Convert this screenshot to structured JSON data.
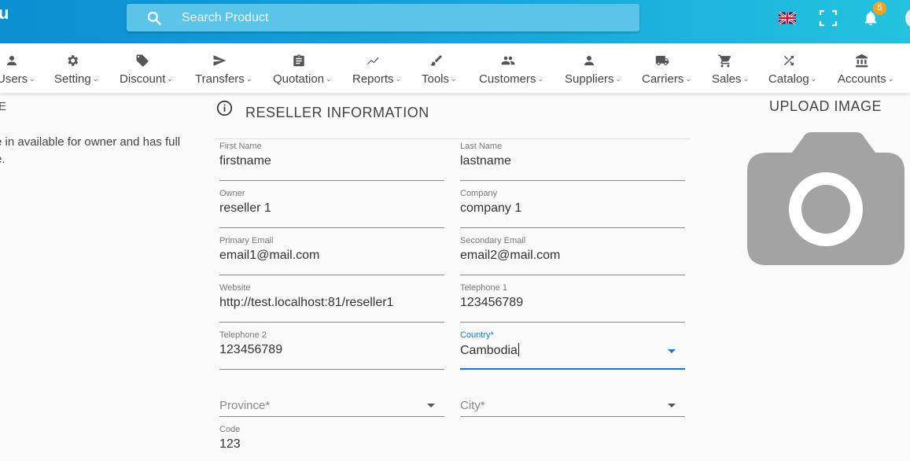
{
  "header": {
    "logo_fragment": "u",
    "search_placeholder": "Search Product",
    "notifications_count": "5",
    "language": "English (UK flag)"
  },
  "nav": {
    "items": [
      {
        "label": "Users",
        "icon": "person-icon"
      },
      {
        "label": "Setting",
        "icon": "gear-icon"
      },
      {
        "label": "Discount",
        "icon": "tag-icon"
      },
      {
        "label": "Transfers",
        "icon": "send-icon"
      },
      {
        "label": "Quotation",
        "icon": "clipboard-icon"
      },
      {
        "label": "Reports",
        "icon": "trend-icon"
      },
      {
        "label": "Tools",
        "icon": "brush-icon"
      },
      {
        "label": "Customers",
        "icon": "people-icon"
      },
      {
        "label": "Suppliers",
        "icon": "person-icon"
      },
      {
        "label": "Carriers",
        "icon": "truck-icon"
      },
      {
        "label": "Sales",
        "icon": "cart-icon"
      },
      {
        "label": "Catalog",
        "icon": "shuffle-icon"
      },
      {
        "label": "Accounts",
        "icon": "bank-icon"
      }
    ]
  },
  "left_panel": {
    "heading_fragment": "E",
    "description": "e in available for owner and has full e."
  },
  "form": {
    "title": "RESELLER INFORMATION",
    "first_name": {
      "label": "First Name",
      "value": "firstname"
    },
    "last_name": {
      "label": "Last Name",
      "value": "lastname"
    },
    "owner": {
      "label": "Owner",
      "value": "reseller 1"
    },
    "company": {
      "label": "Company",
      "value": "company 1"
    },
    "primary_email": {
      "label": "Primary Email",
      "value": "email1@mail.com"
    },
    "secondary_email": {
      "label": "Secondary Email",
      "value": "email2@mail.com"
    },
    "website": {
      "label": "Website",
      "value": "http://test.localhost:81/reseller1"
    },
    "telephone1": {
      "label": "Telephone 1",
      "value": "123456789"
    },
    "telephone2": {
      "label": "Telephone 2",
      "value": "123456789"
    },
    "country": {
      "label": "Country*",
      "value": "Cambodia"
    },
    "province": {
      "placeholder": "Province*"
    },
    "city": {
      "placeholder": "City*"
    },
    "code": {
      "label": "Code",
      "value": "123"
    }
  },
  "upload": {
    "title": "UPLOAD IMAGE"
  },
  "colors": {
    "topbar_start": "#0b8fd3",
    "topbar_end": "#23c3de",
    "accent_blue": "#1976d2",
    "badge_orange": "#f9a21e",
    "camera_gray": "#a3a3a3"
  }
}
